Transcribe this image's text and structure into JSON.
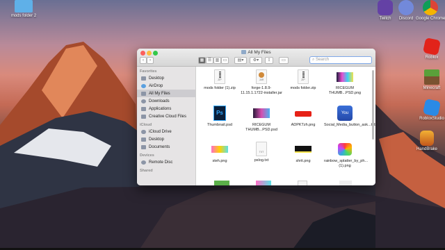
{
  "desktop": {
    "icons": [
      {
        "label": "mods folder 2"
      },
      {
        "label": "Twitch"
      },
      {
        "label": "Discord"
      },
      {
        "label": "Google Chrome"
      },
      {
        "label": "Roblox"
      },
      {
        "label": "Minecraft"
      },
      {
        "label": "RobloxStudio"
      },
      {
        "label": "HandBrake"
      }
    ]
  },
  "window": {
    "title": "All My Files",
    "search_placeholder": "Search",
    "sidebar": {
      "favorites_header": "Favorites",
      "favorites": [
        "Desktop",
        "AirDrop",
        "All My Files",
        "Downloads",
        "Applications",
        "Creative Cloud Files"
      ],
      "icloud_header": "iCloud",
      "icloud": [
        "iCloud Drive",
        "Desktop",
        "Documents"
      ],
      "devices_header": "Devices",
      "devices": [
        "Remote Disc"
      ],
      "shared_header": "Shared"
    },
    "files": [
      {
        "name": "mods folder (1).zip",
        "type": "zip",
        "tag": "ZIP"
      },
      {
        "name": "forge-1.8.9-11.15.1.1722-installer.jar",
        "type": "jar",
        "tag": "JAR"
      },
      {
        "name": "mods folder.zip",
        "type": "zip",
        "tag": "ZIP"
      },
      {
        "name": "RICEGUM THUMB...PSD.png",
        "type": "img"
      },
      {
        "name": "Thumbnail.psd",
        "type": "psd"
      },
      {
        "name": "RICEGUM THUMB...PSD.psd",
        "type": "img"
      },
      {
        "name": "ADPKTzh.png",
        "type": "img"
      },
      {
        "name": "Social_Media_button_ask...tube.png",
        "type": "yt"
      },
      {
        "name": "steh.png",
        "type": "img"
      },
      {
        "name": "pslog.txt",
        "type": "txt",
        "tag": "TXT"
      },
      {
        "name": "shrit.png",
        "type": "img"
      },
      {
        "name": "rainbow_splatter_by_ph...(1).png",
        "type": "img"
      }
    ]
  }
}
